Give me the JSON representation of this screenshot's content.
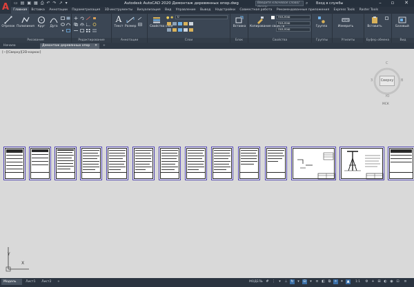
{
  "titlebar": {
    "app_logo": "A",
    "title": "Autodesk AutoCAD 2020   Демонтаж деревянных опор.dwg",
    "search_placeholder": "Введите ключевое слово/фразу",
    "signin": "Вход в службы"
  },
  "ribbon_tabs": [
    "Главная",
    "Вставка",
    "Аннотации",
    "Параметризация",
    "3D-инструменты",
    "Визуализация",
    "Вид",
    "Управление",
    "Вывод",
    "Надстройки",
    "Совместная работа",
    "Рекомендованные приложения",
    "Express Tools",
    "Raster Tools"
  ],
  "ribbon": {
    "draw": {
      "title": "Рисование",
      "line": "Отрезок",
      "polyline": "Полилиния",
      "circle": "Круг",
      "arc": "Дуга"
    },
    "modify": {
      "title": "Редактирование"
    },
    "annotation": {
      "title": "Аннотации",
      "text": "Текст",
      "dimension": "Размер"
    },
    "layers": {
      "title": "Слои",
      "properties": "Свойства слоя",
      "current_layer": "0"
    },
    "block": {
      "title": "Блок",
      "insert": "Вставка"
    },
    "properties": {
      "title": "Свойства",
      "match": "Копирование свойств",
      "bylayer_1": "ПоСлою",
      "bylayer_2": "ПоСлою",
      "bylayer_3": "ПоСлою"
    },
    "groups": {
      "title": "Группы",
      "group": "Группа"
    },
    "utilities": {
      "title": "Утилиты",
      "measure": "Измерить"
    },
    "clipboard": {
      "title": "Буфер обмена",
      "paste": "Вставить"
    },
    "view": {
      "title": "Вид",
      "base": "Базовый"
    }
  },
  "file_tabs": {
    "start": "Начало",
    "drawing": "Демонтаж деревянных опор",
    "add": "+"
  },
  "viewport": {
    "label": "[−][Сверху][2D-каркас]"
  },
  "viewcube": {
    "north": "С",
    "south": "Ю",
    "west": "З",
    "east": "В",
    "face": "Сверху",
    "wcs": "МСК"
  },
  "ucs": {
    "x": "X",
    "y": "Y"
  },
  "status": {
    "tabs": [
      "Модель",
      "Лист1",
      "Лист2"
    ],
    "add": "+",
    "model_label": "МОДЕЛЬ",
    "scale": "1:1"
  }
}
